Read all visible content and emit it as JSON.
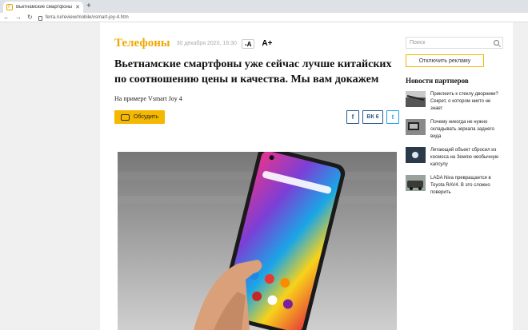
{
  "browser": {
    "tab_title": "Вьетнамские смартфоны уже сейч",
    "tab_close": "✕",
    "new_tab": "+",
    "url": "ferra.ru/review/mobile/vsmart-joy-4.htm",
    "nav": {
      "back": "←",
      "forward": "→",
      "reload": "↻"
    }
  },
  "article": {
    "category": "Телефоны",
    "date": "30 декабря 2020, 16:30",
    "font_smaller": "-A",
    "font_larger": "A+",
    "headline": "Вьетнамские смартфоны уже сейчас лучше китайских по соотношению цены и качества. Мы вам докажем",
    "subtitle": "На примере Vsmart Joy 4",
    "discuss_label": "Обсудить",
    "share": {
      "facebook": "f",
      "vk": "ВК 6",
      "twitter": "t"
    }
  },
  "sidebar": {
    "search_placeholder": "Поиск",
    "ad_button": "Отключить рекламу",
    "partners_title": "Новости партнеров",
    "partners": [
      {
        "text": "Приклеить к стеклу дворники? Секрет, о котором никто не знает"
      },
      {
        "text": "Почему никогда не нужно складывать зеркала заднего вида"
      },
      {
        "text": "Летающий объект сбросил из космоса на Землю необычную капсулу"
      },
      {
        "text": "LADA Niva превращается в Toyota RAV4. В это сложно поверить"
      }
    ]
  },
  "colors": {
    "accent": "#f0a800",
    "share_blue": "#2a5a8c",
    "twitter": "#1da1f2"
  }
}
